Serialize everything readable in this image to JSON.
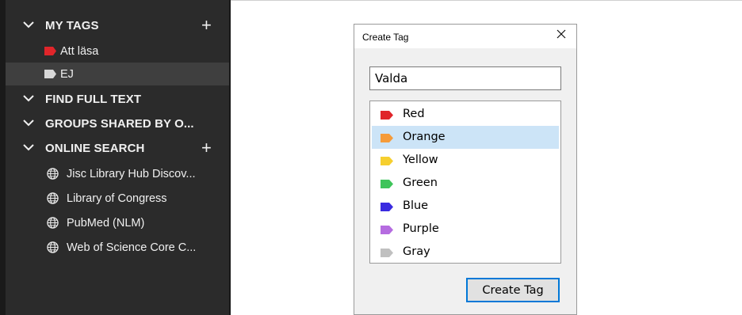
{
  "sidebar": {
    "my_tags": {
      "label": "MY TAGS",
      "add_icon": "plus-icon",
      "tags": [
        {
          "label": "Att läsa",
          "color": "#e0252a"
        },
        {
          "label": "EJ",
          "color": "#d8d8d8"
        }
      ]
    },
    "find_full_text": {
      "label": "FIND FULL TEXT"
    },
    "groups_shared": {
      "label": "GROUPS SHARED BY O..."
    },
    "online_search": {
      "label": "ONLINE SEARCH",
      "add_icon": "plus-icon",
      "items": [
        {
          "label": "Jisc Library Hub Discov..."
        },
        {
          "label": "Library of Congress"
        },
        {
          "label": "PubMed (NLM)"
        },
        {
          "label": "Web of Science Core C..."
        }
      ]
    }
  },
  "dialog": {
    "title": "Create Tag",
    "close_icon": "close-icon",
    "name_value": "Valda",
    "colors": [
      {
        "label": "Red",
        "color": "#e0252a"
      },
      {
        "label": "Orange",
        "color": "#f59b3a",
        "selected": true
      },
      {
        "label": "Yellow",
        "color": "#f6cf2f"
      },
      {
        "label": "Green",
        "color": "#3ec45a"
      },
      {
        "label": "Blue",
        "color": "#3a2be0"
      },
      {
        "label": "Purple",
        "color": "#b56ce0"
      },
      {
        "label": "Gray",
        "color": "#c0c0c0"
      }
    ],
    "create_button": "Create Tag"
  }
}
